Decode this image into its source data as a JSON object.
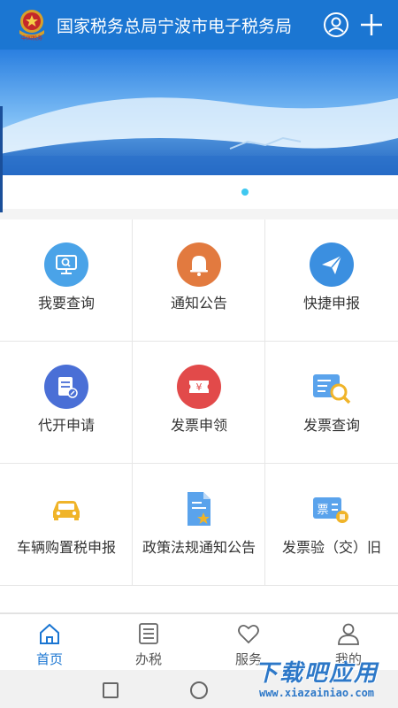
{
  "header": {
    "title": "国家税务总局宁波市电子税务局",
    "emblem_text": "中国税务"
  },
  "banner": {
    "active_index": 0
  },
  "grid": {
    "items": [
      {
        "label": "我要查询",
        "icon": "search-monitor-icon"
      },
      {
        "label": "通知公告",
        "icon": "bell-icon"
      },
      {
        "label": "快捷申报",
        "icon": "paper-plane-icon"
      },
      {
        "label": "代开申请",
        "icon": "document-edit-icon"
      },
      {
        "label": "发票申领",
        "icon": "yuan-ticket-icon"
      },
      {
        "label": "发票查询",
        "icon": "invoice-search-icon"
      },
      {
        "label": "车辆购置税申报",
        "icon": "car-icon"
      },
      {
        "label": "政策法规通知公告",
        "icon": "star-document-icon"
      },
      {
        "label": "发票验（交）旧",
        "icon": "invoice-verify-icon"
      }
    ]
  },
  "tabs": [
    {
      "label": "首页",
      "icon": "home-icon",
      "active": true
    },
    {
      "label": "办税",
      "icon": "list-icon",
      "active": false
    },
    {
      "label": "服务",
      "icon": "heart-icon",
      "active": false
    },
    {
      "label": "我的",
      "icon": "person-icon",
      "active": false
    }
  ],
  "watermark": {
    "title": "下载吧应用",
    "url": "www.xiazainiao.com"
  },
  "colors": {
    "primary": "#1b76d2",
    "query": "#4aa3e8",
    "notice": "#e27a3f",
    "quick": "#3b8fe0",
    "agent": "#4a6fd6",
    "invoice_apply": "#e24a4a",
    "yellow": "#f0b429"
  }
}
